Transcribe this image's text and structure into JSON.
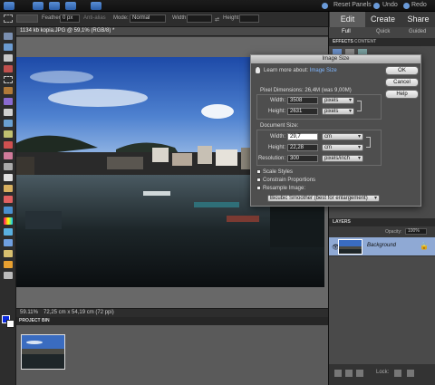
{
  "menubar": {
    "reset_panels": "Reset Panels",
    "undo": "Undo",
    "redo": "Redo"
  },
  "options": {
    "feather_label": "Feather:",
    "feather_value": "0 px",
    "antialias_label": "Anti-alias",
    "mode_label": "Mode:",
    "mode_value": "Normal",
    "width_label": "Width:",
    "height_label": "Height:"
  },
  "document": {
    "tab_label": "1134 kb kopia.JPG @ 59,1% (RGB/8) *",
    "zoom": "59.11%",
    "dims": "72,25 cm x 54,19 cm (72 ppi)"
  },
  "project_bin": {
    "title": "PROJECT BIN"
  },
  "right_panel": {
    "modes": [
      "Edit",
      "Create",
      "Share"
    ],
    "sub_tabs": [
      "Full",
      "Quick",
      "Guided"
    ],
    "panel_tabs": [
      "EFFECTS",
      "CONTENT"
    ],
    "layers_title": "LAYERS",
    "opacity_label": "Opacity:",
    "opacity_value": "100%",
    "layer_name": "Background",
    "lock_label": "Lock:"
  },
  "dialog": {
    "title": "Image Size",
    "learn_prefix": "Learn more about:",
    "learn_link": "Image Size",
    "ok": "OK",
    "cancel": "Cancel",
    "help": "Help",
    "pixel_dims": "Pixel Dimensions:",
    "pixel_dims_value": "26,4M (was 9,00M)",
    "width_label": "Width:",
    "height_label": "Height:",
    "px_width": "3508",
    "px_height": "2631",
    "px_unit": "pixels",
    "doc_size": "Document Size:",
    "doc_width": "29,7",
    "doc_height": "22,28",
    "doc_unit": "cm",
    "resolution_label": "Resolution:",
    "resolution": "300",
    "resolution_unit": "pixels/inch",
    "scale_styles": "Scale Styles",
    "constrain": "Constrain Proportions",
    "resample": "Resample Image:",
    "resample_method": "Bicubic Smoother (best for enlargement)"
  }
}
